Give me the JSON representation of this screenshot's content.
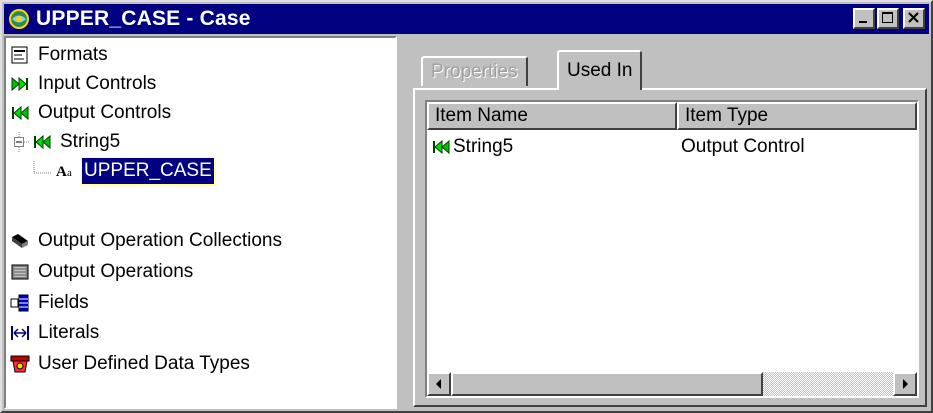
{
  "window": {
    "title": "UPPER_CASE - Case",
    "icon": "application-icon",
    "controls": [
      "minimize-icon",
      "maximize-icon",
      "close-icon"
    ]
  },
  "tree": {
    "items": [
      {
        "label": "Formats",
        "icon": "formats-icon"
      },
      {
        "label": "Input Controls",
        "icon": "input-controls-icon"
      },
      {
        "label": "Output Controls",
        "icon": "output-controls-icon"
      },
      {
        "label": "String5",
        "icon": "output-control-icon",
        "expanded": true
      },
      {
        "label": "UPPER_CASE",
        "icon": "case-icon",
        "selected": true
      },
      {
        "label": "Output Operation Collections",
        "icon": "collection-icon"
      },
      {
        "label": "Output Operations",
        "icon": "operations-icon"
      },
      {
        "label": "Fields",
        "icon": "fields-icon"
      },
      {
        "label": "Literals",
        "icon": "literals-icon"
      },
      {
        "label": "User Defined Data Types",
        "icon": "user-types-icon"
      }
    ]
  },
  "tabs": [
    {
      "label": "Properties",
      "enabled": false
    },
    {
      "label": "Used In",
      "active": true
    }
  ],
  "used_in": {
    "columns": [
      "Item Name",
      "Item Type"
    ],
    "rows": [
      {
        "name": "String5",
        "type": "Output Control",
        "icon": "output-control-icon"
      }
    ]
  },
  "colors": {
    "titlebar": "#000080",
    "face": "#c0c0c0",
    "selection": "#000080"
  }
}
